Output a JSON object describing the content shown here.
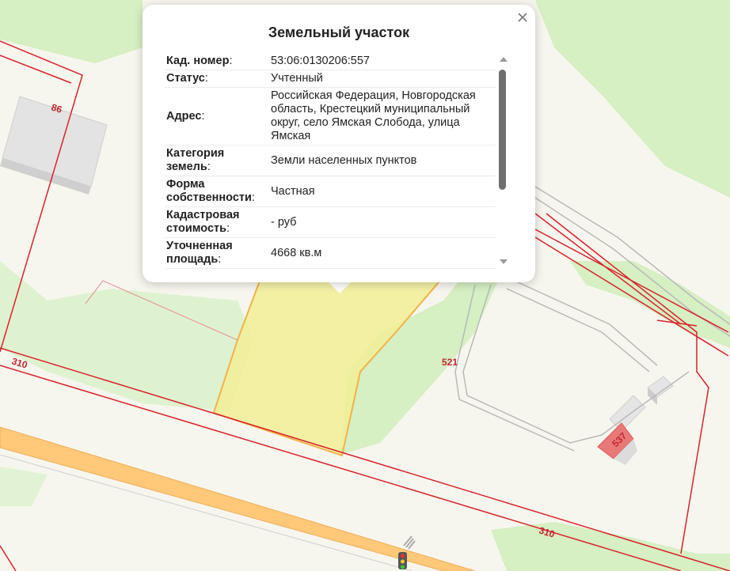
{
  "map": {
    "parcel_labels": {
      "p86": "86",
      "p310a": "310",
      "p310b": "310",
      "p521": "521",
      "p537": "537"
    },
    "colors": {
      "boundary": "#d8232a",
      "green": "#d6efc3",
      "road": "#ffc979",
      "selected_parcel": "#f2ef96",
      "building": "#e3e3e3"
    }
  },
  "popup": {
    "title": "Земельный участок",
    "close_icon": "close-icon",
    "rows": [
      {
        "label": "Кад. номер",
        "value": "53:06:0130206:557"
      },
      {
        "label": "Статус",
        "value": "Учтенный"
      },
      {
        "label": "Адрес",
        "value": "Российская Федерация, Новгородская область, Крестецкий муниципальный округ, село Ямская Слобода, улица Ямская"
      },
      {
        "label": "Категория земель",
        "value": "Земли населенных пунктов"
      },
      {
        "label": "Форма собственности",
        "value": "Частная"
      },
      {
        "label": "Кадастровая стоимость",
        "value": "- руб"
      },
      {
        "label": "Уточненная площадь",
        "value": "4668 кв.м"
      }
    ]
  }
}
